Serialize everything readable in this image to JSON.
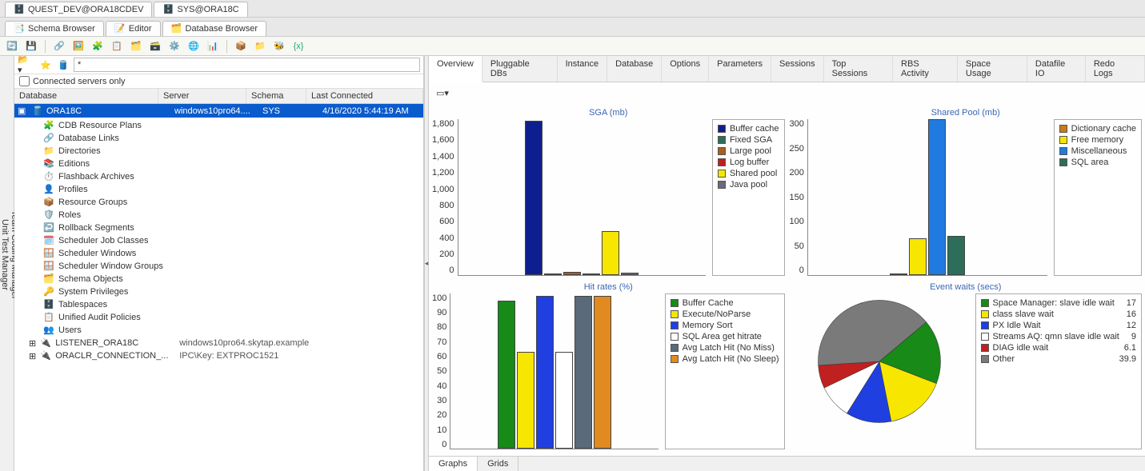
{
  "conn_tabs": [
    {
      "label": "QUEST_DEV@ORA18CDEV",
      "active": false
    },
    {
      "label": "SYS@ORA18C",
      "active": true
    }
  ],
  "view_tabs": [
    {
      "label": "Schema Browser"
    },
    {
      "label": "Editor"
    },
    {
      "label": "Database Browser"
    }
  ],
  "left": {
    "filter_placeholder": "*",
    "connected_only": "Connected servers only",
    "cols": {
      "db": "Database",
      "srv": "Server",
      "sch": "Schema",
      "lc": "Last Connected"
    },
    "row": {
      "name": "ORA18C",
      "server": "windows10pro64....",
      "schema": "SYS",
      "last": "4/16/2020 5:44:19 AM"
    },
    "tree": [
      "CDB Resource Plans",
      "Database Links",
      "Directories",
      "Editions",
      "Flashback Archives",
      "Profiles",
      "Resource Groups",
      "Roles",
      "Rollback Segments",
      "Scheduler Job Classes",
      "Scheduler Windows",
      "Scheduler Window Groups",
      "Schema Objects",
      "System Privileges",
      "Tablespaces",
      "Unified Audit Policies",
      "Users"
    ],
    "listeners": [
      {
        "name": "LISTENER_ORA18C",
        "detail": "windows10pro64.skytap.example"
      },
      {
        "name": "ORACLR_CONNECTION_...",
        "detail": "IPC\\Key: EXTPROC1521"
      }
    ]
  },
  "rails": {
    "a": "Unit Test Manager",
    "b": "Team Coding Manager"
  },
  "rtabs": [
    "Overview",
    "Pluggable DBs",
    "Instance",
    "Database",
    "Options",
    "Parameters",
    "Sessions",
    "Top Sessions",
    "RBS Activity",
    "Space Usage",
    "Datafile IO",
    "Redo Logs"
  ],
  "btabs": [
    "Graphs",
    "Grids"
  ],
  "chart_data": [
    {
      "type": "bar",
      "title": "SGA (mb)",
      "ylim": [
        0,
        1800
      ],
      "ticks": [
        0,
        200,
        400,
        600,
        800,
        1000,
        1200,
        1400,
        1600,
        1800
      ],
      "series": [
        {
          "name": "Buffer cache",
          "value": 1780,
          "color": "#0d1f8f"
        },
        {
          "name": "Fixed SGA",
          "value": 15,
          "color": "#2d6e5a"
        },
        {
          "name": "Large pool",
          "value": 30,
          "color": "#a85f1f"
        },
        {
          "name": "Log buffer",
          "value": 10,
          "color": "#c02020"
        },
        {
          "name": "Shared pool",
          "value": 500,
          "color": "#f7e600"
        },
        {
          "name": "Java pool",
          "value": 25,
          "color": "#6a6a7a"
        }
      ]
    },
    {
      "type": "bar",
      "title": "Shared Pool (mb)",
      "ylim": [
        0,
        320
      ],
      "ticks": [
        0,
        50,
        100,
        150,
        200,
        250,
        300
      ],
      "series": [
        {
          "name": "Dictionary cache",
          "value": 3,
          "color": "#c97a1a"
        },
        {
          "name": "Free memory",
          "value": 75,
          "color": "#f7e600"
        },
        {
          "name": "Miscellaneous",
          "value": 320,
          "color": "#1f7be0"
        },
        {
          "name": "SQL area",
          "value": 80,
          "color": "#2d6e5a"
        }
      ]
    },
    {
      "type": "bar",
      "title": "Hit rates (%)",
      "ylim": [
        0,
        100
      ],
      "ticks": [
        0,
        10,
        20,
        30,
        40,
        50,
        60,
        70,
        80,
        90,
        100
      ],
      "series": [
        {
          "name": "Buffer Cache",
          "value": 95,
          "color": "#178a17"
        },
        {
          "name": "Execute/NoParse",
          "value": 62,
          "color": "#f7e600"
        },
        {
          "name": "Memory Sort",
          "value": 98,
          "color": "#1f3fe0"
        },
        {
          "name": "SQL Area get hitrate",
          "value": 62,
          "color": "#ffffff"
        },
        {
          "name": "Avg Latch Hit (No Miss)",
          "value": 98,
          "color": "#5a6a7a"
        },
        {
          "name": "Avg Latch Hit (No Sleep)",
          "value": 98,
          "color": "#e08a1f"
        }
      ]
    },
    {
      "type": "pie",
      "title": "Event waits (secs)",
      "slices": [
        {
          "name": "Space Manager: slave idle wait",
          "value": 17,
          "color": "#178a17"
        },
        {
          "name": "class slave wait",
          "value": 16,
          "color": "#f7e600",
          "hl": true
        },
        {
          "name": "PX Idle Wait",
          "value": 12,
          "color": "#1f3fe0"
        },
        {
          "name": "Streams AQ: qmn slave idle wait",
          "value": 9,
          "color": "#ffffff"
        },
        {
          "name": "DIAG idle wait",
          "value": 6.1,
          "color": "#c02020"
        },
        {
          "name": "Other",
          "value": 39.9,
          "color": "#7a7a7a"
        }
      ]
    }
  ]
}
